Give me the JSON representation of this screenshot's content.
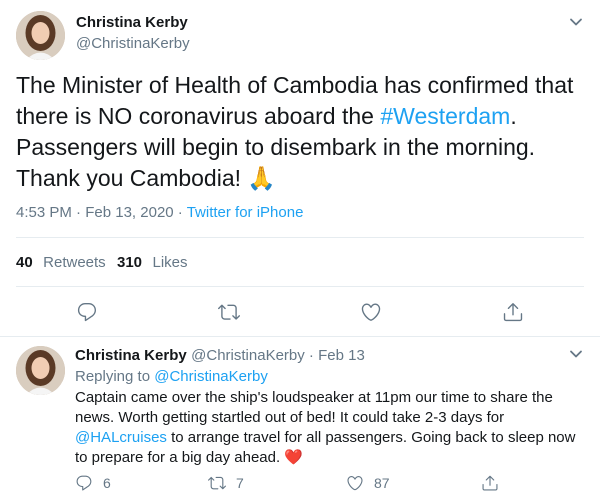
{
  "main_tweet": {
    "author_name": "Christina Kerby",
    "author_handle": "@ChristinaKerby",
    "text_line1": "The Minister of Health of Cambodia has confirmed that",
    "text_line2_pre": "there is NO coronavirus aboard the ",
    "hashtag": "#Westerdam",
    "text_line2_post": ".",
    "text_line3": "Passengers will begin to disembark in the morning.",
    "text_line4": "Thank you Cambodia! ",
    "emoji": "🙏",
    "time": "4:53 PM",
    "separator": " · ",
    "date": "Feb 13, 2020",
    "client": "Twitter for iPhone",
    "retweets_count": "40",
    "retweets_label": "Retweets",
    "likes_count": "310",
    "likes_label": "Likes"
  },
  "reply_tweet": {
    "author_name": "Christina Kerby",
    "author_handle": "@ChristinaKerby",
    "separator": " · ",
    "date": "Feb 13",
    "replying_to_label": "Replying to ",
    "replying_to_handle": "@ChristinaKerby",
    "line1": "Captain came over the ship's loudspeaker at 11pm our time to share the",
    "line2": "news. Worth getting startled out of bed! It could take 2-3 days for",
    "mention": "@HALcruises",
    "line3_post": " to arrange travel for all passengers. Going back to sleep now",
    "line4": "to prepare for a big day ahead. ",
    "heart_emoji": "❤️",
    "reply_count": "6",
    "retweet_count": "7",
    "like_count": "87"
  },
  "colors": {
    "accent": "#1da1f2",
    "secondary_text": "#657786",
    "divider": "#e6ecf0",
    "heart": "#e0245e"
  },
  "icons": {
    "reply": "reply-icon",
    "retweet": "retweet-icon",
    "like": "heart-icon",
    "share": "share-icon",
    "menu": "chevron-down-icon"
  }
}
